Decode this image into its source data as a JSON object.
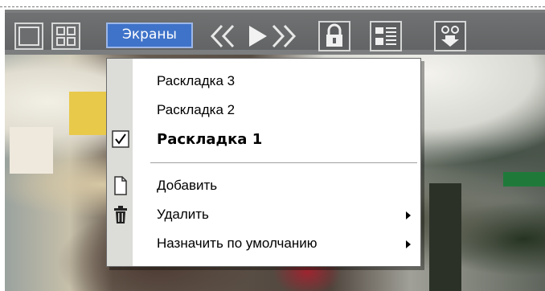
{
  "toolbar": {
    "screens_label": "Экраны",
    "icons": [
      "single-layout-icon",
      "grid-layout-icon",
      "prev-icon",
      "play-icon",
      "next-icon",
      "lock-icon",
      "list-icon",
      "download-icon"
    ]
  },
  "menu": {
    "items": [
      {
        "label": "Раскладка 3"
      },
      {
        "label": "Раскладка 2"
      },
      {
        "label": "Раскладка 1",
        "checked": true
      },
      {
        "label": "Добавить",
        "icon": "document-icon"
      },
      {
        "label": "Удалить",
        "icon": "trash-icon",
        "submenu": true
      },
      {
        "label": "Назначить по умолчанию",
        "submenu": true
      }
    ]
  },
  "colors": {
    "toolbar_bg": "#6f7172",
    "accent": "#3f73c9",
    "menu_bg": "#ffffff",
    "gutter": "#dcdcd8"
  }
}
